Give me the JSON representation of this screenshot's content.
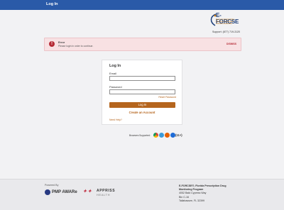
{
  "header": {
    "title": "Log In"
  },
  "logo": {
    "name": "E-FORCSE",
    "tagline": "Electronic-Florida Online Reporting of Controlled Substance Evaluation"
  },
  "support": {
    "text": "Support: (877) 719-3120"
  },
  "alert": {
    "title": "Error",
    "message": "Please login in order to continue.",
    "dismiss": "DISMISS"
  },
  "login": {
    "title": "Log In",
    "email_label": "Email",
    "email_value": "",
    "password_label": "Password",
    "password_value": "",
    "reset_link": "Reset Password",
    "submit_label": "Log In",
    "create_account": "Create an Account",
    "help_link": "Need Help?"
  },
  "browsers": {
    "label": "Browsers Supported:",
    "items": [
      "chrome-icon",
      "safari-icon",
      "firefox-icon",
      "edge-icon"
    ],
    "ie_label": "(11+)"
  },
  "footer": {
    "powered_by": "Powered By",
    "pmp_brand": "PMP AWARe",
    "appriss_top": "APPRISS",
    "appriss_bottom": "HEALTH",
    "address": {
      "line1": "E-FORCSE®, Florida Prescription Drug",
      "line2": "Monitoring Program",
      "line3": "4052 Bald Cypress Way",
      "line4": "Bin C-16",
      "line5": "Tallahassee, FL 32399"
    }
  },
  "colors": {
    "topbar": "#2a5aa8",
    "accent": "#b5651d",
    "error": "#b52a35"
  }
}
